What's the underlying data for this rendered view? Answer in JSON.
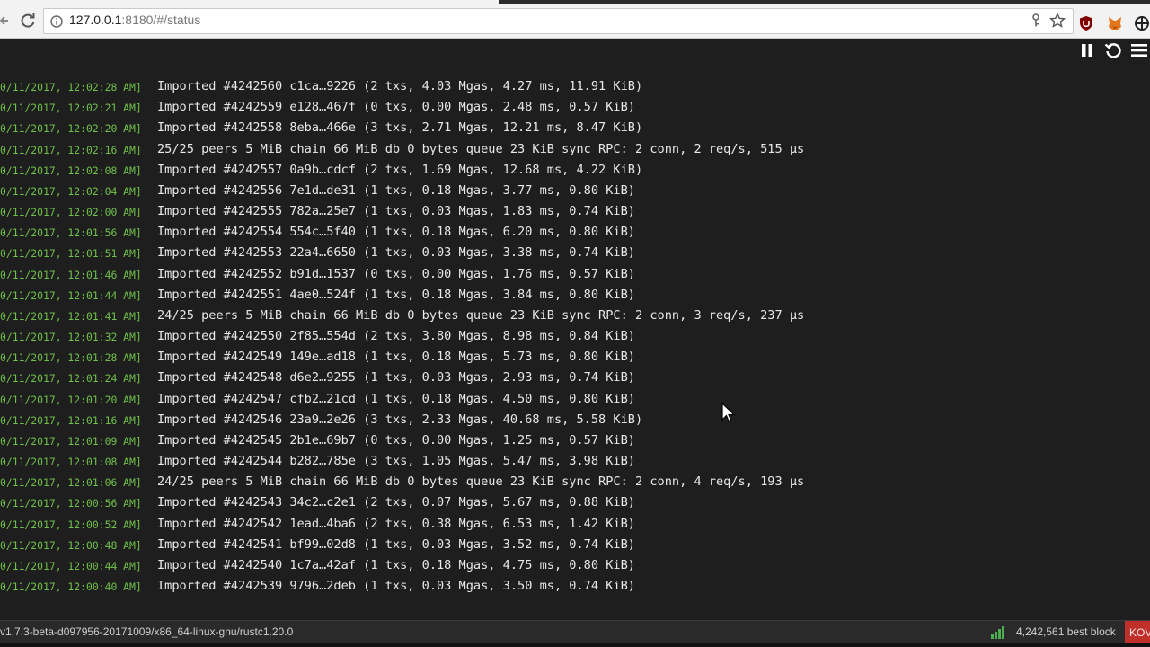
{
  "browser": {
    "url_host": "127.0.0.1",
    "url_rest": ":8180/#/status"
  },
  "log": [
    {
      "ts": "0/11/2017, 12:02:28 AM]",
      "msg": "Imported #4242560 c1ca…9226 (2 txs, 4.03 Mgas, 4.27 ms, 11.91 KiB)"
    },
    {
      "ts": "0/11/2017, 12:02:21 AM]",
      "msg": "Imported #4242559 e128…467f (0 txs, 0.00 Mgas, 2.48 ms, 0.57 KiB)"
    },
    {
      "ts": "0/11/2017, 12:02:20 AM]",
      "msg": "Imported #4242558 8eba…466e (3 txs, 2.71 Mgas, 12.21 ms, 8.47 KiB)"
    },
    {
      "ts": "0/11/2017, 12:02:16 AM]",
      "msg": "25/25 peers 5 MiB chain 66 MiB db 0 bytes queue 23 KiB sync RPC: 2 conn, 2 req/s, 515 µs"
    },
    {
      "ts": "0/11/2017, 12:02:08 AM]",
      "msg": "Imported #4242557 0a9b…cdcf (2 txs, 1.69 Mgas, 12.68 ms, 4.22 KiB)"
    },
    {
      "ts": "0/11/2017, 12:02:04 AM]",
      "msg": "Imported #4242556 7e1d…de31 (1 txs, 0.18 Mgas, 3.77 ms, 0.80 KiB)"
    },
    {
      "ts": "0/11/2017, 12:02:00 AM]",
      "msg": "Imported #4242555 782a…25e7 (1 txs, 0.03 Mgas, 1.83 ms, 0.74 KiB)"
    },
    {
      "ts": "0/11/2017, 12:01:56 AM]",
      "msg": "Imported #4242554 554c…5f40 (1 txs, 0.18 Mgas, 6.20 ms, 0.80 KiB)"
    },
    {
      "ts": "0/11/2017, 12:01:51 AM]",
      "msg": "Imported #4242553 22a4…6650 (1 txs, 0.03 Mgas, 3.38 ms, 0.74 KiB)"
    },
    {
      "ts": "0/11/2017, 12:01:46 AM]",
      "msg": "Imported #4242552 b91d…1537 (0 txs, 0.00 Mgas, 1.76 ms, 0.57 KiB)"
    },
    {
      "ts": "0/11/2017, 12:01:44 AM]",
      "msg": "Imported #4242551 4ae0…524f (1 txs, 0.18 Mgas, 3.84 ms, 0.80 KiB)"
    },
    {
      "ts": "0/11/2017, 12:01:41 AM]",
      "msg": "24/25 peers 5 MiB chain 66 MiB db 0 bytes queue 23 KiB sync RPC: 2 conn, 3 req/s, 237 µs"
    },
    {
      "ts": "0/11/2017, 12:01:32 AM]",
      "msg": "Imported #4242550 2f85…554d (2 txs, 3.80 Mgas, 8.98 ms, 0.84 KiB)"
    },
    {
      "ts": "0/11/2017, 12:01:28 AM]",
      "msg": "Imported #4242549 149e…ad18 (1 txs, 0.18 Mgas, 5.73 ms, 0.80 KiB)"
    },
    {
      "ts": "0/11/2017, 12:01:24 AM]",
      "msg": "Imported #4242548 d6e2…9255 (1 txs, 0.03 Mgas, 2.93 ms, 0.74 KiB)"
    },
    {
      "ts": "0/11/2017, 12:01:20 AM]",
      "msg": "Imported #4242547 cfb2…21cd (1 txs, 0.18 Mgas, 4.50 ms, 0.80 KiB)"
    },
    {
      "ts": "0/11/2017, 12:01:16 AM]",
      "msg": "Imported #4242546 23a9…2e26 (3 txs, 2.33 Mgas, 40.68 ms, 5.58 KiB)"
    },
    {
      "ts": "0/11/2017, 12:01:09 AM]",
      "msg": "Imported #4242545 2b1e…69b7 (0 txs, 0.00 Mgas, 1.25 ms, 0.57 KiB)"
    },
    {
      "ts": "0/11/2017, 12:01:08 AM]",
      "msg": "Imported #4242544 b282…785e (3 txs, 1.05 Mgas, 5.47 ms, 3.98 KiB)"
    },
    {
      "ts": "0/11/2017, 12:01:06 AM]",
      "msg": "24/25 peers 5 MiB chain 66 MiB db 0 bytes queue 23 KiB sync RPC: 2 conn, 4 req/s, 193 µs"
    },
    {
      "ts": "0/11/2017, 12:00:56 AM]",
      "msg": "Imported #4242543 34c2…c2e1 (2 txs, 0.07 Mgas, 5.67 ms, 0.88 KiB)"
    },
    {
      "ts": "0/11/2017, 12:00:52 AM]",
      "msg": "Imported #4242542 1ead…4ba6 (2 txs, 0.38 Mgas, 6.53 ms, 1.42 KiB)"
    },
    {
      "ts": "0/11/2017, 12:00:48 AM]",
      "msg": "Imported #4242541 bf99…02d8 (1 txs, 0.03 Mgas, 3.52 ms, 0.74 KiB)"
    },
    {
      "ts": "0/11/2017, 12:00:44 AM]",
      "msg": "Imported #4242540 1c7a…42af (1 txs, 0.18 Mgas, 4.75 ms, 0.80 KiB)"
    },
    {
      "ts": "0/11/2017, 12:00:40 AM]",
      "msg": "Imported #4242539 9796…2deb (1 txs, 0.03 Mgas, 3.50 ms, 0.74 KiB)"
    }
  ],
  "statusbar": {
    "version": "v1.7.3-beta-d097956-20171009/x86_64-linux-gnu/rustc1.20.0",
    "best_block": "4,242,561 best block",
    "chain": "KOV"
  },
  "icons": {
    "back": "back-arrow-icon",
    "reload": "reload-icon",
    "info": "info-icon",
    "key": "key-icon",
    "star": "bookmark-star-icon",
    "shield": "ublock-shield-icon",
    "fox": "metamask-fox-icon",
    "ext3": "extension-icon",
    "pause": "pause-icon",
    "refresh": "refresh-icon",
    "menu": "menu-icon",
    "signal": "signal-bars-icon",
    "cursor": "mouse-cursor-icon"
  },
  "colors": {
    "background": "#1e1e1e",
    "timestamp": "#6fbf4a",
    "log_text": "#e8e8e8",
    "chain_badge": "#c0302a"
  }
}
